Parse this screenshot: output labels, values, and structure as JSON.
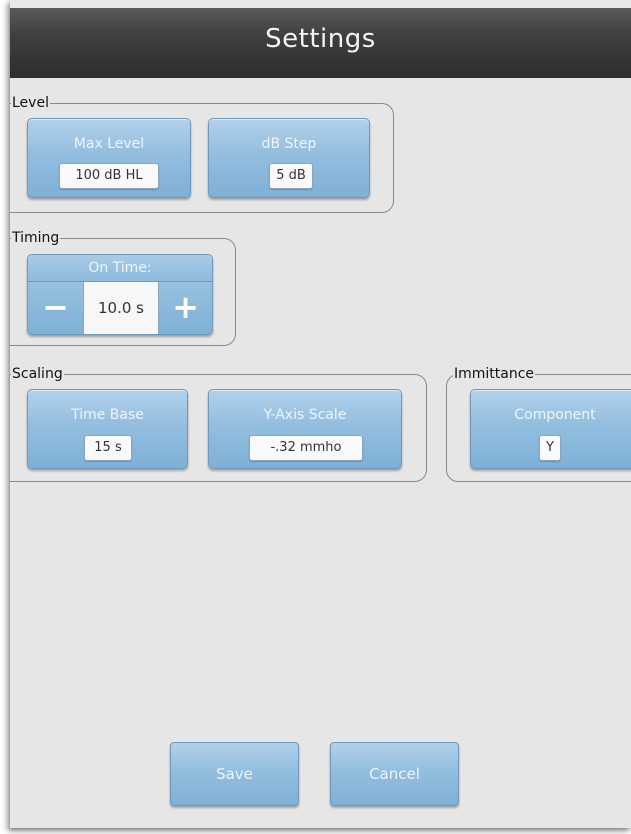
{
  "window": {
    "title": "Settings"
  },
  "level": {
    "legend": "Level",
    "max_level": {
      "label": "Max Level",
      "value": "100 dB HL"
    },
    "db_step": {
      "label": "dB Step",
      "value": "5 dB"
    }
  },
  "timing": {
    "legend": "Timing",
    "on_time": {
      "label": "On Time:",
      "value": "10.0 s",
      "decrement": "−",
      "increment": "+"
    }
  },
  "scaling": {
    "legend": "Scaling",
    "time_base": {
      "label": "Time Base",
      "value": "15 s"
    },
    "y_axis_scale": {
      "label": "Y-Axis Scale",
      "value": "-.32 mmho"
    }
  },
  "immittance": {
    "legend": "Immittance",
    "component": {
      "label": "Component",
      "value": "Y"
    }
  },
  "actions": {
    "save_label": "Save",
    "cancel_label": "Cancel"
  },
  "colors": {
    "title_bar": "#3f3f3f",
    "tile_blue": "#93bedf",
    "background": "#e6e6e6"
  }
}
